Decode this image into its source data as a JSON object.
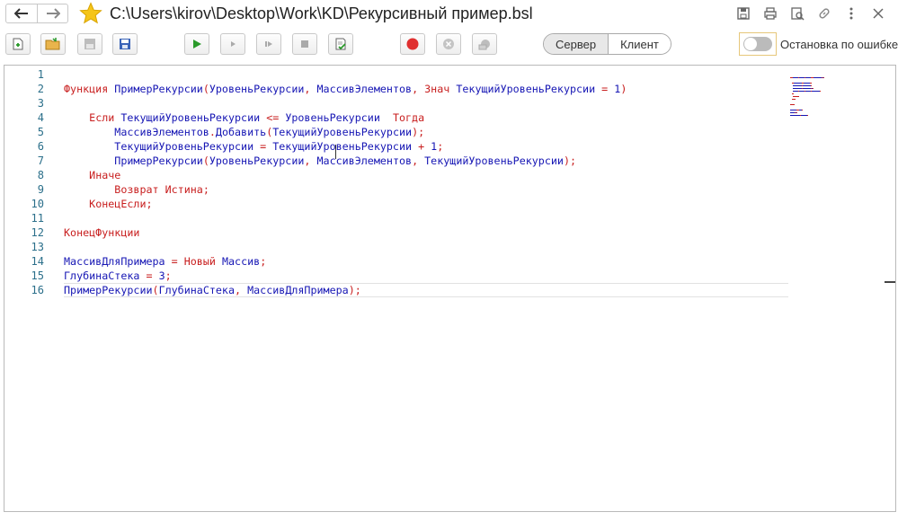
{
  "window": {
    "title": "C:\\Users\\kirov\\Desktop\\Work\\KD\\Рекурсивный пример.bsl",
    "back_icon": "arrow-left-icon",
    "forward_icon": "arrow-right-icon",
    "favorite_icon": "star-icon"
  },
  "title_tools": [
    "save-icon",
    "print-icon",
    "preview-icon",
    "link-icon",
    "more-icon",
    "close-icon"
  ],
  "toolbar": {
    "buttons": [
      "new-file-icon",
      "open-folder-icon",
      "save-disabled-icon",
      "save-icon",
      "run-icon",
      "step-icon",
      "step-over-icon",
      "stop-icon",
      "check-syntax-icon",
      "breakpoint-icon",
      "clear-breakpoint-icon",
      "disable-breakpoints-icon"
    ],
    "mode_segment": {
      "server": "Сервер",
      "client": "Клиент",
      "selected": "Сервер"
    },
    "stop_on_error_label": "Остановка по ошибке",
    "stop_on_error_enabled": false
  },
  "colors": {
    "keyword": "#c81e1e",
    "identifier": "#1616b4",
    "line_number": "#2b6f8a",
    "accent_stop": "#e03030",
    "accent_run": "#2a9a2a"
  },
  "editor": {
    "line_numbers": [
      "1",
      "2",
      "3",
      "4",
      "5",
      "6",
      "7",
      "8",
      "9",
      "10",
      "11",
      "12",
      "13",
      "14",
      "15",
      "16"
    ],
    "lines": [
      [],
      [
        {
          "t": "Функция ",
          "c": "kw"
        },
        {
          "t": "ПримерРекурсии",
          "c": "id"
        },
        {
          "t": "(",
          "c": "op"
        },
        {
          "t": "УровеньРекурсии",
          "c": "id"
        },
        {
          "t": ", ",
          "c": "op"
        },
        {
          "t": "МассивЭлементов",
          "c": "id"
        },
        {
          "t": ", ",
          "c": "op"
        },
        {
          "t": "Знач ",
          "c": "kw"
        },
        {
          "t": "ТекущийУровеньРекурсии",
          "c": "id"
        },
        {
          "t": " = ",
          "c": "op"
        },
        {
          "t": "1",
          "c": "num"
        },
        {
          "t": ")",
          "c": "op"
        }
      ],
      [],
      [
        {
          "t": "    ",
          "c": "id"
        },
        {
          "t": "Если ",
          "c": "kw"
        },
        {
          "t": "ТекущийУровеньРекурсии",
          "c": "id"
        },
        {
          "t": " <= ",
          "c": "op"
        },
        {
          "t": "УровеньРекурсии  ",
          "c": "id"
        },
        {
          "t": "Тогда",
          "c": "kw"
        }
      ],
      [
        {
          "t": "        ",
          "c": "id"
        },
        {
          "t": "МассивЭлементов",
          "c": "id"
        },
        {
          "t": ".",
          "c": "op"
        },
        {
          "t": "Добавить",
          "c": "id"
        },
        {
          "t": "(",
          "c": "op"
        },
        {
          "t": "ТекущийУровеньРекурсии",
          "c": "id"
        },
        {
          "t": ");",
          "c": "op"
        }
      ],
      [
        {
          "t": "        ",
          "c": "id"
        },
        {
          "t": "ТекущийУровеньРекурсии",
          "c": "id"
        },
        {
          "t": " = ",
          "c": "op"
        },
        {
          "t": "ТекущийУровеньРекурсии",
          "c": "id"
        },
        {
          "t": " + ",
          "c": "op"
        },
        {
          "t": "1",
          "c": "num"
        },
        {
          "t": ";",
          "c": "op"
        }
      ],
      [
        {
          "t": "        ",
          "c": "id"
        },
        {
          "t": "ПримерРекурсии",
          "c": "id"
        },
        {
          "t": "(",
          "c": "op"
        },
        {
          "t": "УровеньРекурсии",
          "c": "id"
        },
        {
          "t": ", ",
          "c": "op"
        },
        {
          "t": "МассивЭлементов",
          "c": "id"
        },
        {
          "t": ", ",
          "c": "op"
        },
        {
          "t": "ТекущийУровеньРекурсии",
          "c": "id"
        },
        {
          "t": ");",
          "c": "op"
        }
      ],
      [
        {
          "t": "    ",
          "c": "id"
        },
        {
          "t": "Иначе",
          "c": "kw"
        }
      ],
      [
        {
          "t": "        ",
          "c": "id"
        },
        {
          "t": "Возврат Истина",
          "c": "kw"
        },
        {
          "t": ";",
          "c": "op"
        }
      ],
      [
        {
          "t": "    ",
          "c": "id"
        },
        {
          "t": "КонецЕсли",
          "c": "kw"
        },
        {
          "t": ";",
          "c": "op"
        }
      ],
      [],
      [
        {
          "t": "КонецФункции",
          "c": "kw"
        }
      ],
      [],
      [
        {
          "t": "МассивДляПримера",
          "c": "id"
        },
        {
          "t": " = ",
          "c": "op"
        },
        {
          "t": "Новый ",
          "c": "kw"
        },
        {
          "t": "Массив",
          "c": "id"
        },
        {
          "t": ";",
          "c": "op"
        }
      ],
      [
        {
          "t": "ГлубинаСтека",
          "c": "id"
        },
        {
          "t": " = ",
          "c": "op"
        },
        {
          "t": "3",
          "c": "num"
        },
        {
          "t": ";",
          "c": "op"
        }
      ],
      [
        {
          "t": "ПримерРекурсии",
          "c": "id"
        },
        {
          "t": "(",
          "c": "op"
        },
        {
          "t": "ГлубинаСтека",
          "c": "id"
        },
        {
          "t": ", ",
          "c": "op"
        },
        {
          "t": "МассивДляПримера",
          "c": "id"
        },
        {
          "t": ");",
          "c": "op"
        }
      ]
    ],
    "current_line": 16
  }
}
